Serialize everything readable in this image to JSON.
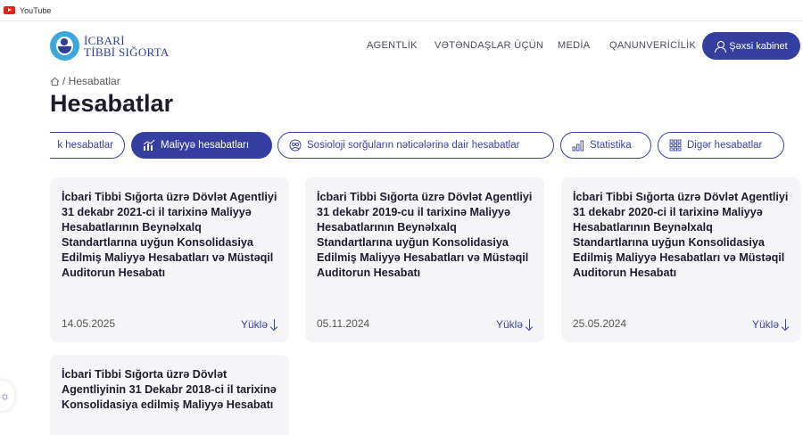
{
  "browser": {
    "bookmark_label": "YouTube"
  },
  "site": {
    "logo_line1": "İCBARİ",
    "logo_line2": "TİBBİ SIĞORTA",
    "brand_color": "#353f9f"
  },
  "nav": {
    "items": [
      "AGENTLİK",
      "VƏTƏNDAŞLAR ÜÇÜN",
      "MEDİA",
      "QANUNVERİCİLİK"
    ],
    "cabinet_label": "Şəxsi kabinet"
  },
  "breadcrumb": {
    "text": "/ Hesabatlar"
  },
  "page_title": "Hesabatlar",
  "tabs": [
    {
      "label": "k hesabatlar",
      "active": false,
      "icon": ""
    },
    {
      "label": "Maliyyə hesabatları",
      "active": true,
      "icon": "finance-chart-icon"
    },
    {
      "label": "Sosioloji sorğuların nəticələrinə dair hesabatlar",
      "active": false,
      "icon": "survey-icon"
    },
    {
      "label": "Statistika",
      "active": false,
      "icon": "bar-chart-icon"
    },
    {
      "label": "Digər hesabatlar",
      "active": false,
      "icon": "grid-icon"
    }
  ],
  "cards": [
    {
      "title": "İcbari Tibbi Sığorta üzrə Dövlət Agentliyi 31 dekabr 2021-ci il tarixinə Maliyyə Hesabatlarının Beynəlxalq Standartlarına uyğun Konsolidasiya Edilmiş Maliyyə Hesabatları və Müstəqil Auditorun Hesabatı",
      "date": "14.05.2025",
      "download": "Yüklə"
    },
    {
      "title": "İcbari Tibbi Sığorta üzrə Dövlət Agentliyi 31 dekabr 2019-cu il tarixinə Maliyyə Hesabatlarının Beynəlxalq Standartlarına uyğun Konsolidasiya Edilmiş Maliyyə Hesabatları və Müstəqil Auditorun Hesabatı",
      "date": "05.11.2024",
      "download": "Yüklə"
    },
    {
      "title": "İcbari Tibbi Sığorta üzrə Dövlət Agentliyi 31 dekabr 2020-ci il tarixinə Maliyyə Hesabatlarının Beynəlxalq Standartlarına uyğun Konsolidasiya Edilmiş Maliyyə Hesabatları və Müstəqil Auditorun Hesabatı",
      "date": "25.05.2024",
      "download": "Yüklə"
    },
    {
      "title": "İcbari Tibbi Sığorta üzrə Dövlət Agentliyinin 31 Dekabr 2018-ci il tarixinə Konsolidasiya edilmiş Maliyyə Hesabatı",
      "date": "",
      "download": ""
    }
  ]
}
